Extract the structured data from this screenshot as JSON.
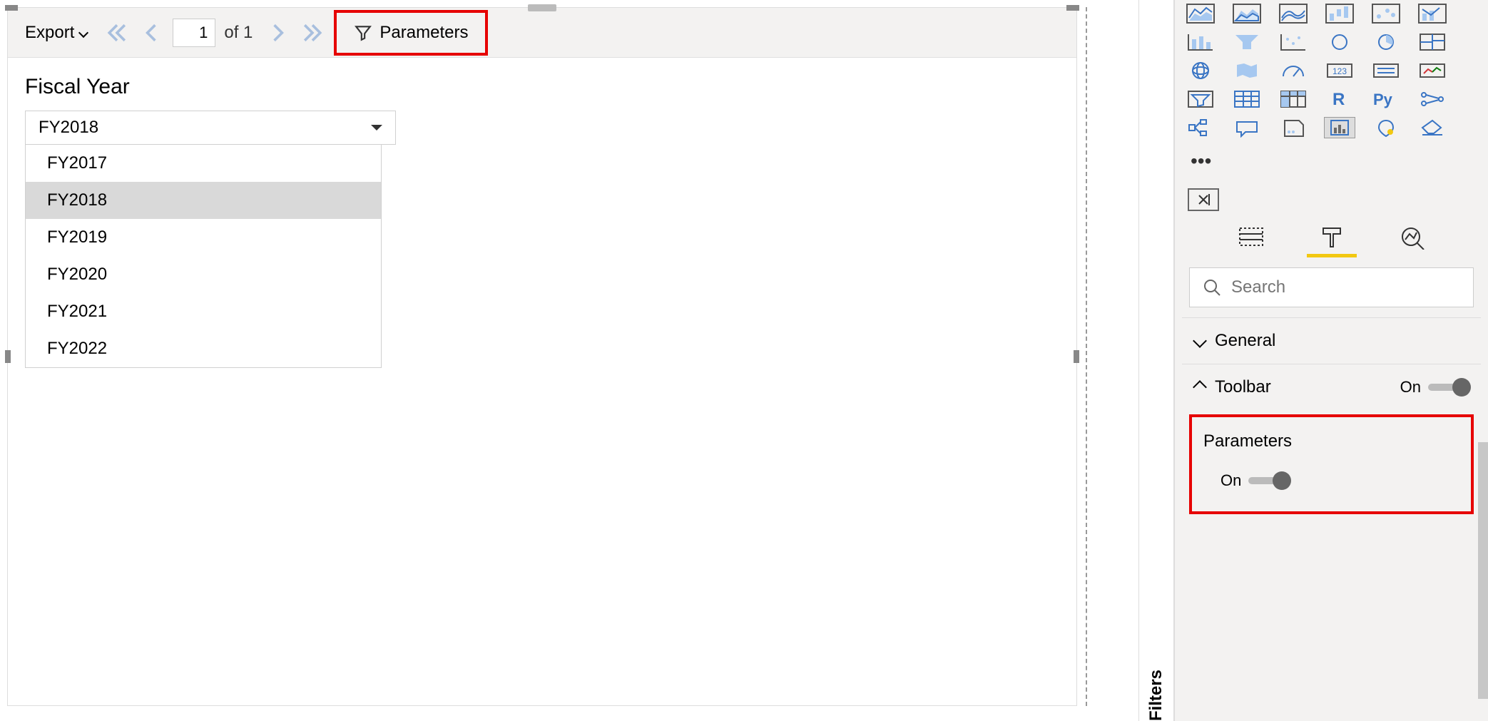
{
  "toolbar": {
    "export_label": "Export",
    "page_current": "1",
    "page_of": "of 1",
    "parameters_label": "Parameters"
  },
  "report": {
    "param_title": "Fiscal Year",
    "selected_value": "FY2018",
    "options": [
      "FY2017",
      "FY2018",
      "FY2019",
      "FY2020",
      "FY2021",
      "FY2022"
    ],
    "selected_index": 1
  },
  "filters_tab": "Filters",
  "search": {
    "placeholder": "Search"
  },
  "format": {
    "general_label": "General",
    "toolbar_label": "Toolbar",
    "toolbar_state": "On",
    "parameters_label": "Parameters",
    "parameters_state": "On"
  },
  "viz_icons": [
    "area-chart",
    "stacked-area",
    "ribbon",
    "waterfall",
    "scatter",
    "line-column",
    "column",
    "funnel",
    "dot",
    "donut",
    "pie",
    "treemap",
    "map",
    "filled-map",
    "gauge",
    "card",
    "multi-card",
    "kpi",
    "matrix",
    "table",
    "pivot",
    "r-visual",
    "py-visual",
    "key-influencers",
    "decomp",
    "qa",
    "smart-narrative",
    "paginated",
    "arc-gis",
    "shape"
  ]
}
